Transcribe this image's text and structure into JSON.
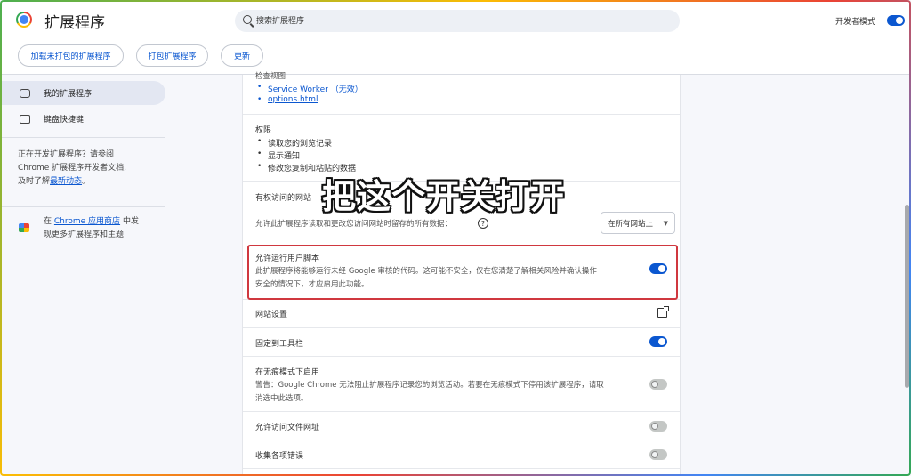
{
  "header": {
    "title": "扩展程序",
    "search_placeholder": "搜索扩展程序",
    "dev_mode_label": "开发者模式",
    "dev_mode_on": true,
    "buttons": {
      "load_unpacked": "加载未打包的扩展程序",
      "pack": "打包扩展程序",
      "update": "更新"
    }
  },
  "sidebar": {
    "items": [
      {
        "label": "我的扩展程序",
        "active": true
      },
      {
        "label": "键盘快捷键",
        "active": false
      }
    ],
    "dev_text_1": "正在开发扩展程序？请参阅",
    "dev_text_2": "Chrome 扩展程序开发者文档,",
    "dev_text_3": "及时了解",
    "dev_link": "最新动态",
    "dev_text_end": "。",
    "store_prefix": "在",
    "store_link": "Chrome 应用商店",
    "store_suffix_1": "中发",
    "store_suffix_2": "现更多扩展程序和主题"
  },
  "main": {
    "inspect_label": "检查视图",
    "inspect_links": [
      "Service Worker （无效）",
      "options.html"
    ],
    "permissions_title": "权限",
    "permissions": [
      "读取您的浏览记录",
      "显示通知",
      "修改您复制和粘贴的数据"
    ],
    "site_access_title": "有权访问的网站",
    "site_access_desc": "允许此扩展程序读取和更改您访问网站时留存的所有数据：",
    "site_access_select": "在所有网站上",
    "user_scripts_title": "允许运行用户脚本",
    "user_scripts_desc_1": "此扩展程序将能够运行未经 Google 审核的代码。这可能不安全，仅在您清楚了解相关风险并确认操作",
    "user_scripts_desc_2": "安全的情况下，才应启用此功能。",
    "user_scripts_on": true,
    "site_settings": "网站设置",
    "pin_toolbar": "固定到工具栏",
    "pin_toolbar_on": true,
    "incognito_title": "在无痕模式下启用",
    "incognito_desc_1": "警告：Google Chrome 无法阻止扩展程序记录您的浏览活动。若要在无痕模式下停用该扩展程序，请取",
    "incognito_desc_2": "消选中此选项。",
    "incognito_on": false,
    "file_urls": "允许访问文件网址",
    "file_urls_on": false,
    "collect_errors": "收集各项错误",
    "collect_errors_on": false
  },
  "annotation": "把这个开关打开",
  "colors": {
    "accent": "#0b57d0",
    "highlight_border": "#d0383f"
  }
}
